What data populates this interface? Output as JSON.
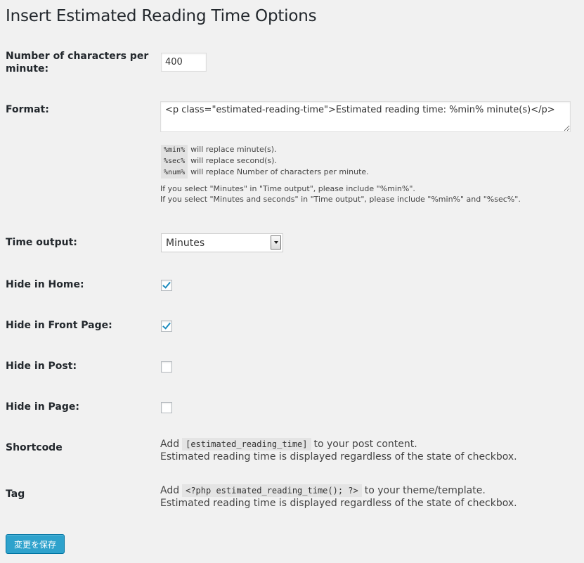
{
  "page": {
    "title": "Insert Estimated Reading Time Options"
  },
  "fields": {
    "chars_per_minute": {
      "label": "Number of characters per minute:",
      "value": "400"
    },
    "format": {
      "label": "Format:",
      "value": "<p class=\"estimated-reading-time\">Estimated reading time: %min% minute(s)</p>",
      "codes": [
        {
          "tag": "%min%",
          "desc": "will replace minute(s)."
        },
        {
          "tag": "%sec%",
          "desc": "will replace second(s)."
        },
        {
          "tag": "%num%",
          "desc": "will replace Number of characters per minute."
        }
      ],
      "notes": [
        "If you select \"Minutes\" in \"Time output\", please include \"%min%\".",
        "If you select \"Minutes and seconds\" in \"Time output\", please include \"%min%\" and \"%sec%\"."
      ]
    },
    "time_output": {
      "label": "Time output:",
      "selected": "Minutes"
    },
    "hide_home": {
      "label": "Hide in Home:",
      "checked": true
    },
    "hide_front_page": {
      "label": "Hide in Front Page:",
      "checked": true
    },
    "hide_post": {
      "label": "Hide in Post:",
      "checked": false
    },
    "hide_page": {
      "label": "Hide in Page:",
      "checked": false
    },
    "shortcode": {
      "label": "Shortcode",
      "prefix": "Add",
      "code": "[estimated_reading_time]",
      "suffix": "to your post content.",
      "note": "Estimated reading time is displayed regardless of the state of checkbox."
    },
    "tag": {
      "label": "Tag",
      "prefix": "Add",
      "code": "<?php estimated_reading_time(); ?>",
      "suffix": "to your theme/template.",
      "note": "Estimated reading time is displayed regardless of the state of checkbox."
    }
  },
  "actions": {
    "save_label": "変更を保存"
  },
  "colors": {
    "background": "#f1f1f1",
    "accent": "#2ea2cc",
    "check": "#1e8cbe"
  }
}
